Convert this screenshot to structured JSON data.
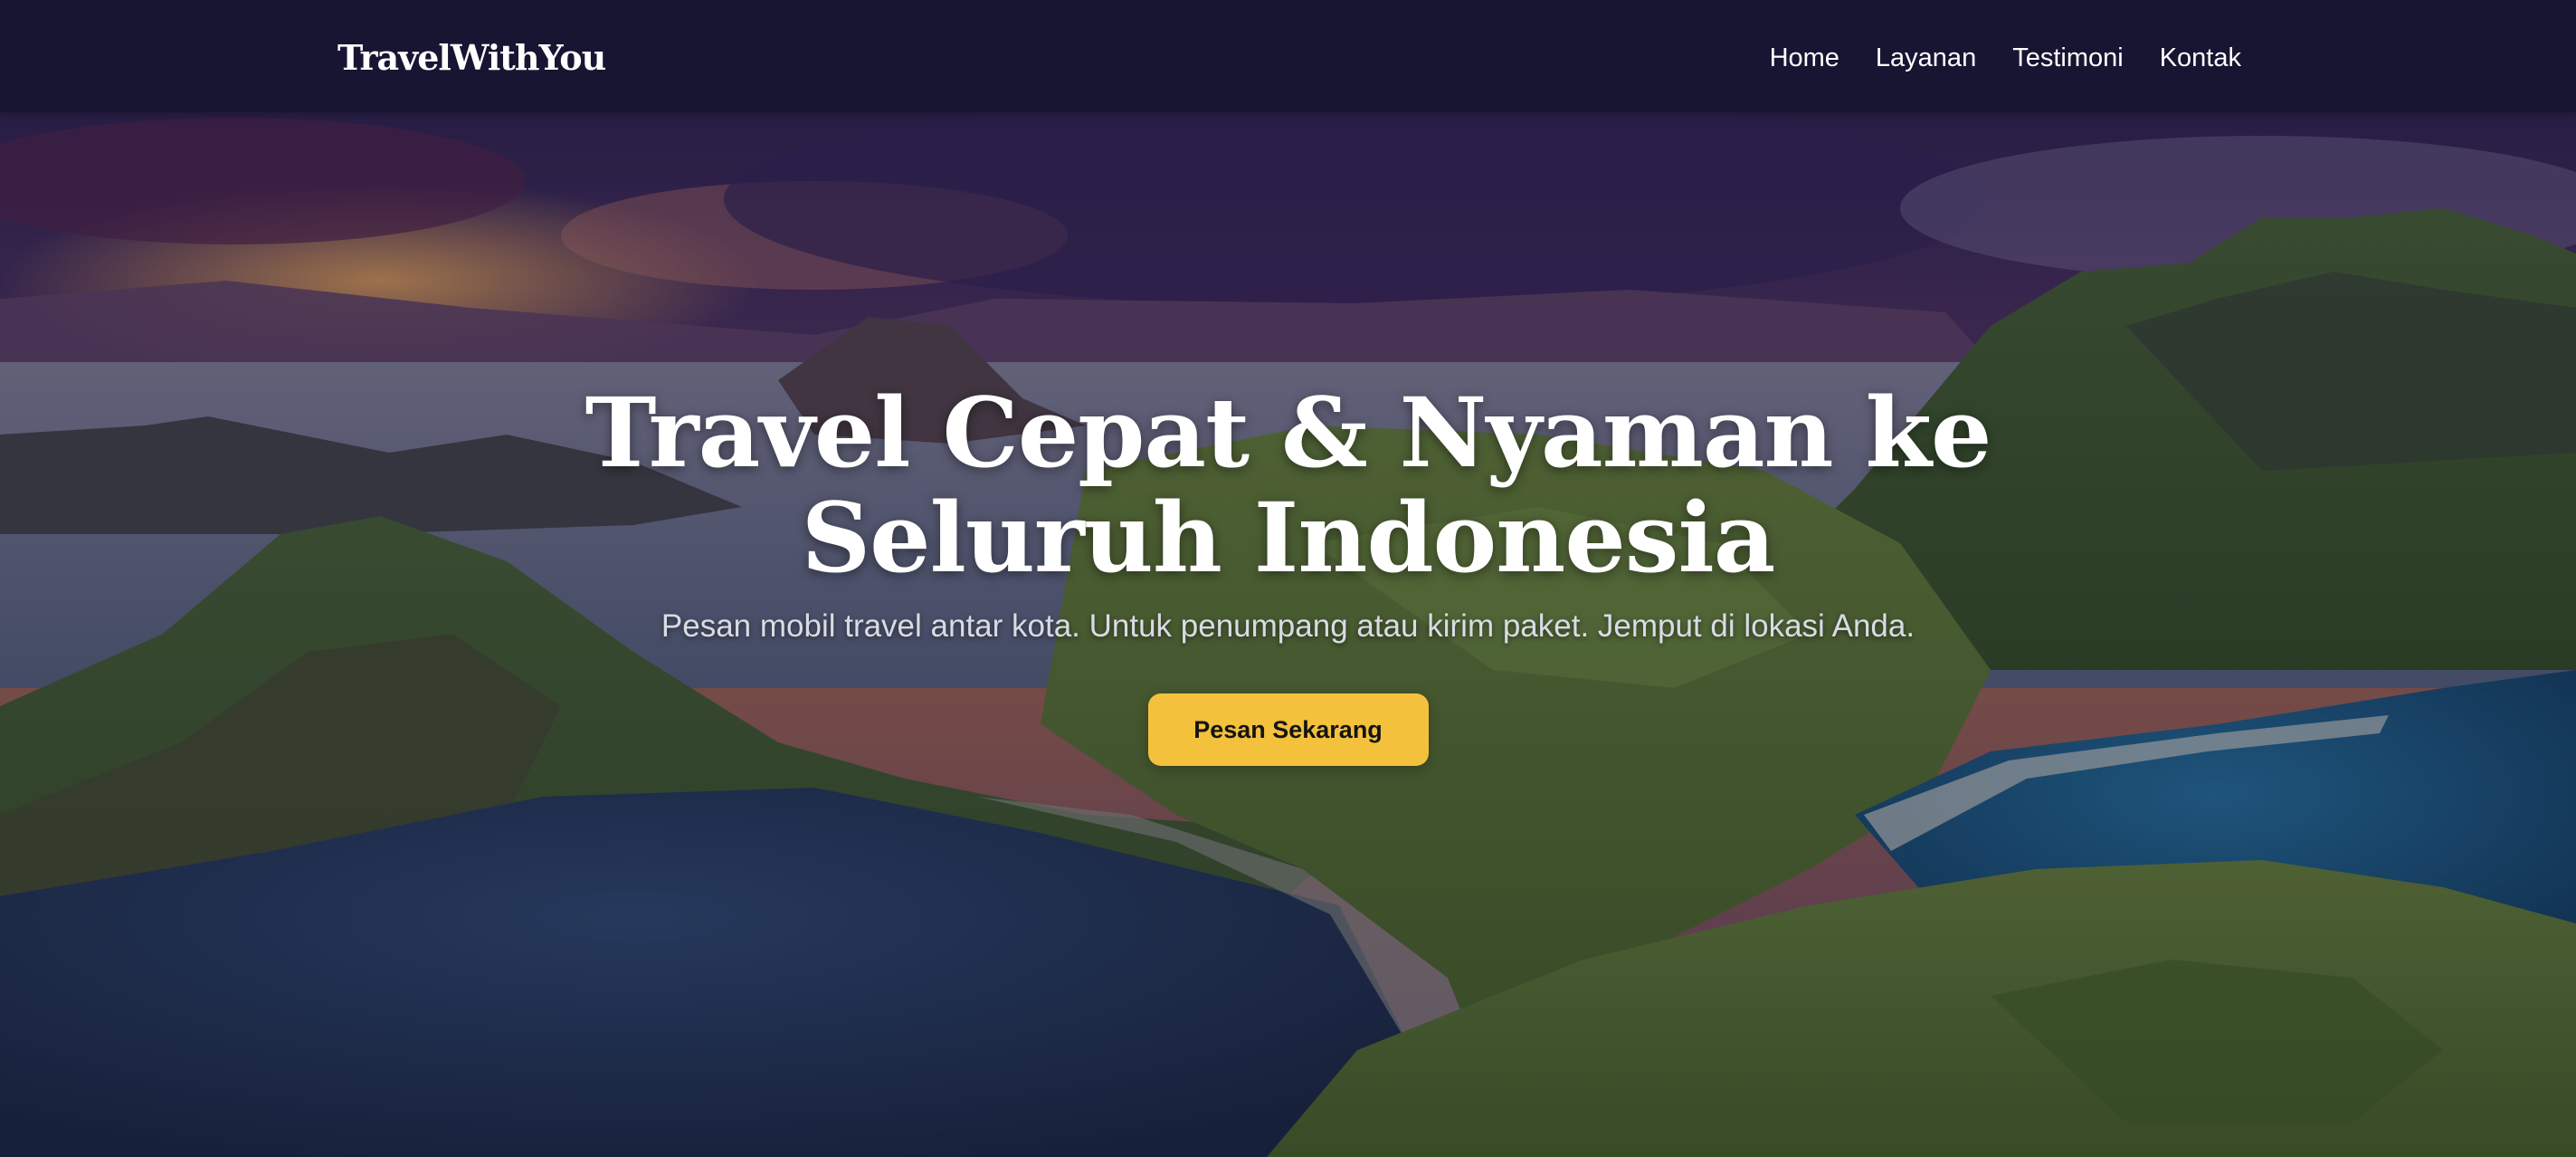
{
  "navbar": {
    "brand": "TravelWithYou",
    "links": [
      {
        "label": "Home"
      },
      {
        "label": "Layanan"
      },
      {
        "label": "Testimoni"
      },
      {
        "label": "Kontak"
      }
    ]
  },
  "hero": {
    "title": "Travel Cepat & Nyaman ke Seluruh Indonesia",
    "subtitle": "Pesan mobil travel antar kota. Untuk penumpang atau kirim paket. Jemput di lokasi Anda.",
    "cta_label": "Pesan Sekarang",
    "background": "sunset-island-landscape"
  },
  "colors": {
    "navbar": "#161430",
    "accent": "#f4c13d",
    "text": "#ffffff",
    "subtitle": "#d9dbe4"
  }
}
